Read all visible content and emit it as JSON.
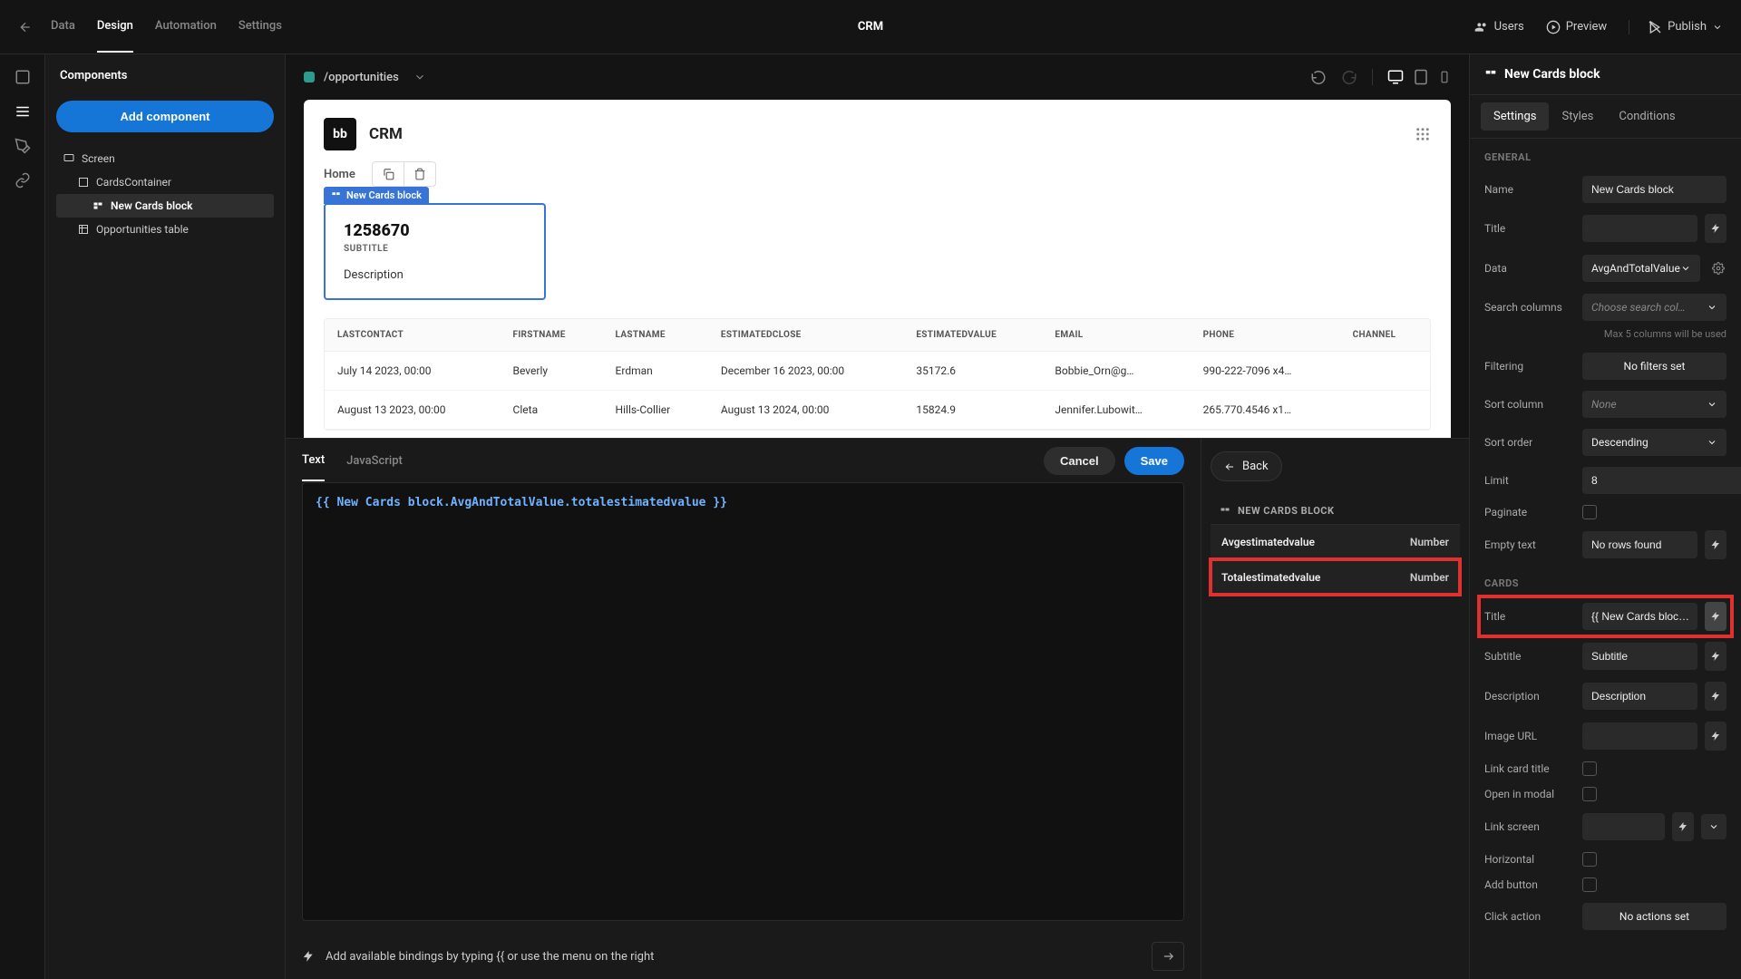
{
  "topbar": {
    "tabs": [
      "Data",
      "Design",
      "Automation",
      "Settings"
    ],
    "active_tab": 1,
    "title": "CRM",
    "users": "Users",
    "preview": "Preview",
    "publish": "Publish"
  },
  "leftpanel": {
    "title": "Components",
    "add_btn": "Add component",
    "tree": [
      {
        "label": "Screen",
        "indent": 0,
        "icon": "screen"
      },
      {
        "label": "CardsContainer",
        "indent": 1,
        "icon": "container"
      },
      {
        "label": "New Cards block",
        "indent": 2,
        "icon": "cards",
        "selected": true
      },
      {
        "label": "Opportunities table",
        "indent": 1,
        "icon": "table"
      }
    ]
  },
  "canvas": {
    "path": "/opportunities",
    "app_logo_text": "bb",
    "app_name": "CRM",
    "home": "Home",
    "card_label": "New Cards block",
    "card": {
      "title": "1258670",
      "subtitle": "SUBTITLE",
      "description": "Description"
    },
    "table": {
      "headers": [
        "LASTCONTACT",
        "FIRSTNAME",
        "LASTNAME",
        "ESTIMATEDCLOSE",
        "ESTIMATEDVALUE",
        "EMAIL",
        "PHONE",
        "CHANNEL"
      ],
      "rows": [
        [
          "July 14 2023, 00:00",
          "Beverly",
          "Erdman",
          "December 16 2023, 00:00",
          "35172.6",
          "Bobbie_Orn@g…",
          "990-222-7096 x4…",
          ""
        ],
        [
          "August 13 2023, 00:00",
          "Cleta",
          "Hills-Collier",
          "August 13 2024, 00:00",
          "15824.9",
          "Jennifer.Lubowit…",
          "265.770.4546 x1…",
          ""
        ]
      ]
    }
  },
  "editor": {
    "tabs": [
      "Text",
      "JavaScript"
    ],
    "active": 0,
    "cancel": "Cancel",
    "save": "Save",
    "code": "{{ New Cards block.AvgAndTotalValue.totalestimatedvalue }}",
    "hint": "Add available bindings by typing {{ or use the menu on the right",
    "back": "Back",
    "context_title": "NEW CARDS BLOCK",
    "context_rows": [
      {
        "k": "Avgestimatedvalue",
        "v": "Number"
      },
      {
        "k": "Totalestimatedvalue",
        "v": "Number",
        "hl": true
      }
    ]
  },
  "rightpanel": {
    "title": "New Cards block",
    "tabs": [
      "Settings",
      "Styles",
      "Conditions"
    ],
    "active_tab": 0,
    "sections": {
      "general": "GENERAL",
      "cards": "CARDS"
    },
    "props": {
      "name": {
        "label": "Name",
        "value": "New Cards block"
      },
      "title": {
        "label": "Title",
        "value": ""
      },
      "data": {
        "label": "Data",
        "value": "AvgAndTotalValue"
      },
      "search_columns": {
        "label": "Search columns",
        "placeholder": "Choose search col…"
      },
      "search_note": "Max 5 columns will be used",
      "filtering": {
        "label": "Filtering",
        "value": "No filters set"
      },
      "sort_column": {
        "label": "Sort column",
        "value": "None"
      },
      "sort_order": {
        "label": "Sort order",
        "value": "Descending"
      },
      "limit": {
        "label": "Limit",
        "value": "8"
      },
      "paginate": {
        "label": "Paginate"
      },
      "empty_text": {
        "label": "Empty text",
        "value": "No rows found"
      },
      "card_title": {
        "label": "Title",
        "value": "{{ New Cards bloc…"
      },
      "subtitle": {
        "label": "Subtitle",
        "value": "Subtitle"
      },
      "description": {
        "label": "Description",
        "value": "Description"
      },
      "image_url": {
        "label": "Image URL",
        "value": ""
      },
      "link_card_title": {
        "label": "Link card title"
      },
      "open_in_modal": {
        "label": "Open in modal"
      },
      "link_screen": {
        "label": "Link screen"
      },
      "horizontal": {
        "label": "Horizontal"
      },
      "add_button": {
        "label": "Add button"
      },
      "click_action": {
        "label": "Click action",
        "value": "No actions set"
      }
    }
  }
}
